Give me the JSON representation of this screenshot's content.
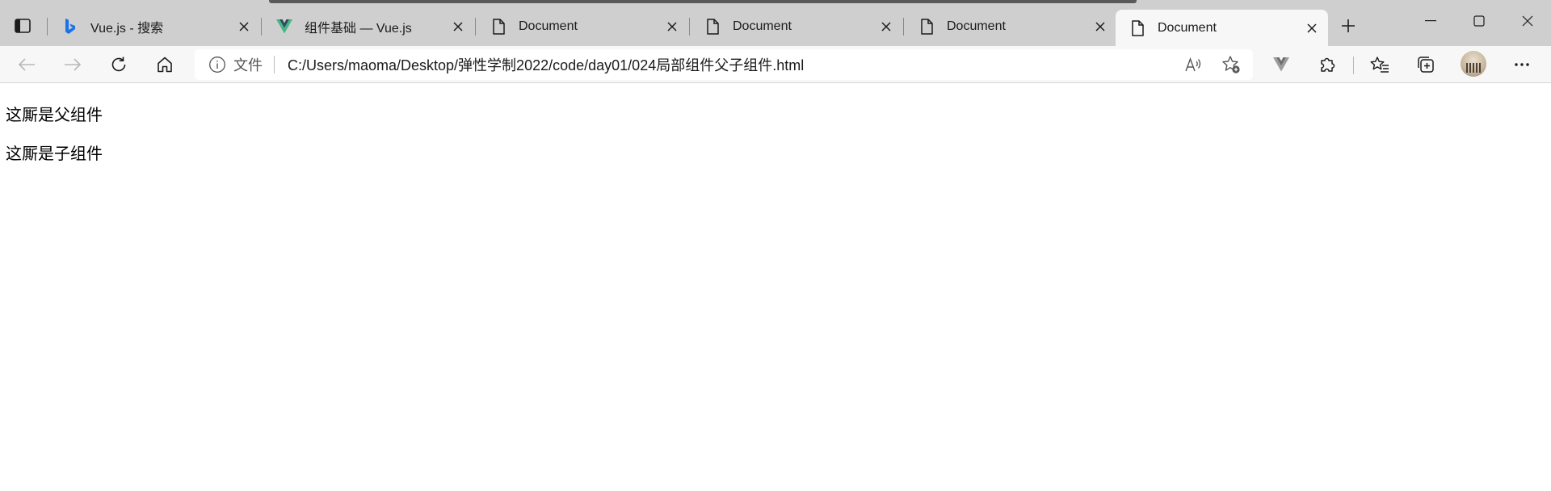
{
  "tabs": [
    {
      "title": "Vue.js - 搜索",
      "favicon": "bing-icon",
      "active": false
    },
    {
      "title": "组件基础 — Vue.js",
      "favicon": "vue-icon",
      "active": false
    },
    {
      "title": "Document",
      "favicon": "document-icon",
      "active": false
    },
    {
      "title": "Document",
      "favicon": "document-icon",
      "active": false
    },
    {
      "title": "Document",
      "favicon": "document-icon",
      "active": false
    },
    {
      "title": "Document",
      "favicon": "document-icon",
      "active": true
    }
  ],
  "address_bar": {
    "file_label": "文件",
    "url": "C:/Users/maoma/Desktop/弹性学制2022/code/day01/024局部组件父子组件.html"
  },
  "page": {
    "parent_text": "这厮是父组件",
    "child_text": "这厮是子组件"
  },
  "colors": {
    "tabstrip_bg": "#cfcfcf",
    "toolbar_bg": "#f7f7f7",
    "vue_green": "#41b883",
    "vue_dark": "#35495e",
    "bing_blue": "#1a73e8"
  }
}
